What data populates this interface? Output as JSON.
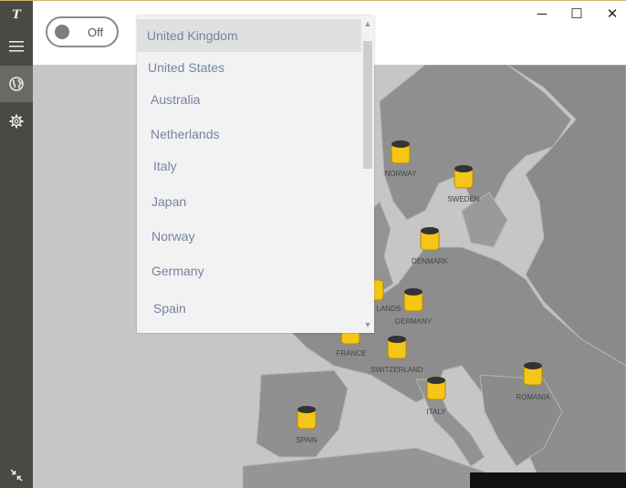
{
  "app": {
    "logo_text": "T"
  },
  "toggle": {
    "state_label": "Off"
  },
  "window_controls": {
    "minimize": "─",
    "maximize": "☐",
    "close": "✕"
  },
  "dropdown": {
    "selected": "United Kingdom",
    "items": [
      {
        "label": "United Kingdom"
      },
      {
        "label": "United States"
      },
      {
        "label": "Australia"
      },
      {
        "label": "Netherlands"
      },
      {
        "label": "Italy"
      },
      {
        "label": "Japan"
      },
      {
        "label": "Norway"
      },
      {
        "label": "Germany"
      },
      {
        "label": "Spain"
      }
    ]
  },
  "map": {
    "servers": [
      {
        "label": "NORWAY"
      },
      {
        "label": "SWEDEN"
      },
      {
        "label": "DENMARK"
      },
      {
        "label": "LANDS"
      },
      {
        "label": "GERMANY"
      },
      {
        "label": "FRANCE"
      },
      {
        "label": "SWITZERLAND"
      },
      {
        "label": "ITALY"
      },
      {
        "label": "ROMANIA"
      },
      {
        "label": "SPAIN"
      }
    ]
  },
  "colors": {
    "sidebar": "#4a4a44",
    "marker": "#f5c518",
    "map_land": "#8e8e8e",
    "map_sea": "#c4c4c4"
  }
}
